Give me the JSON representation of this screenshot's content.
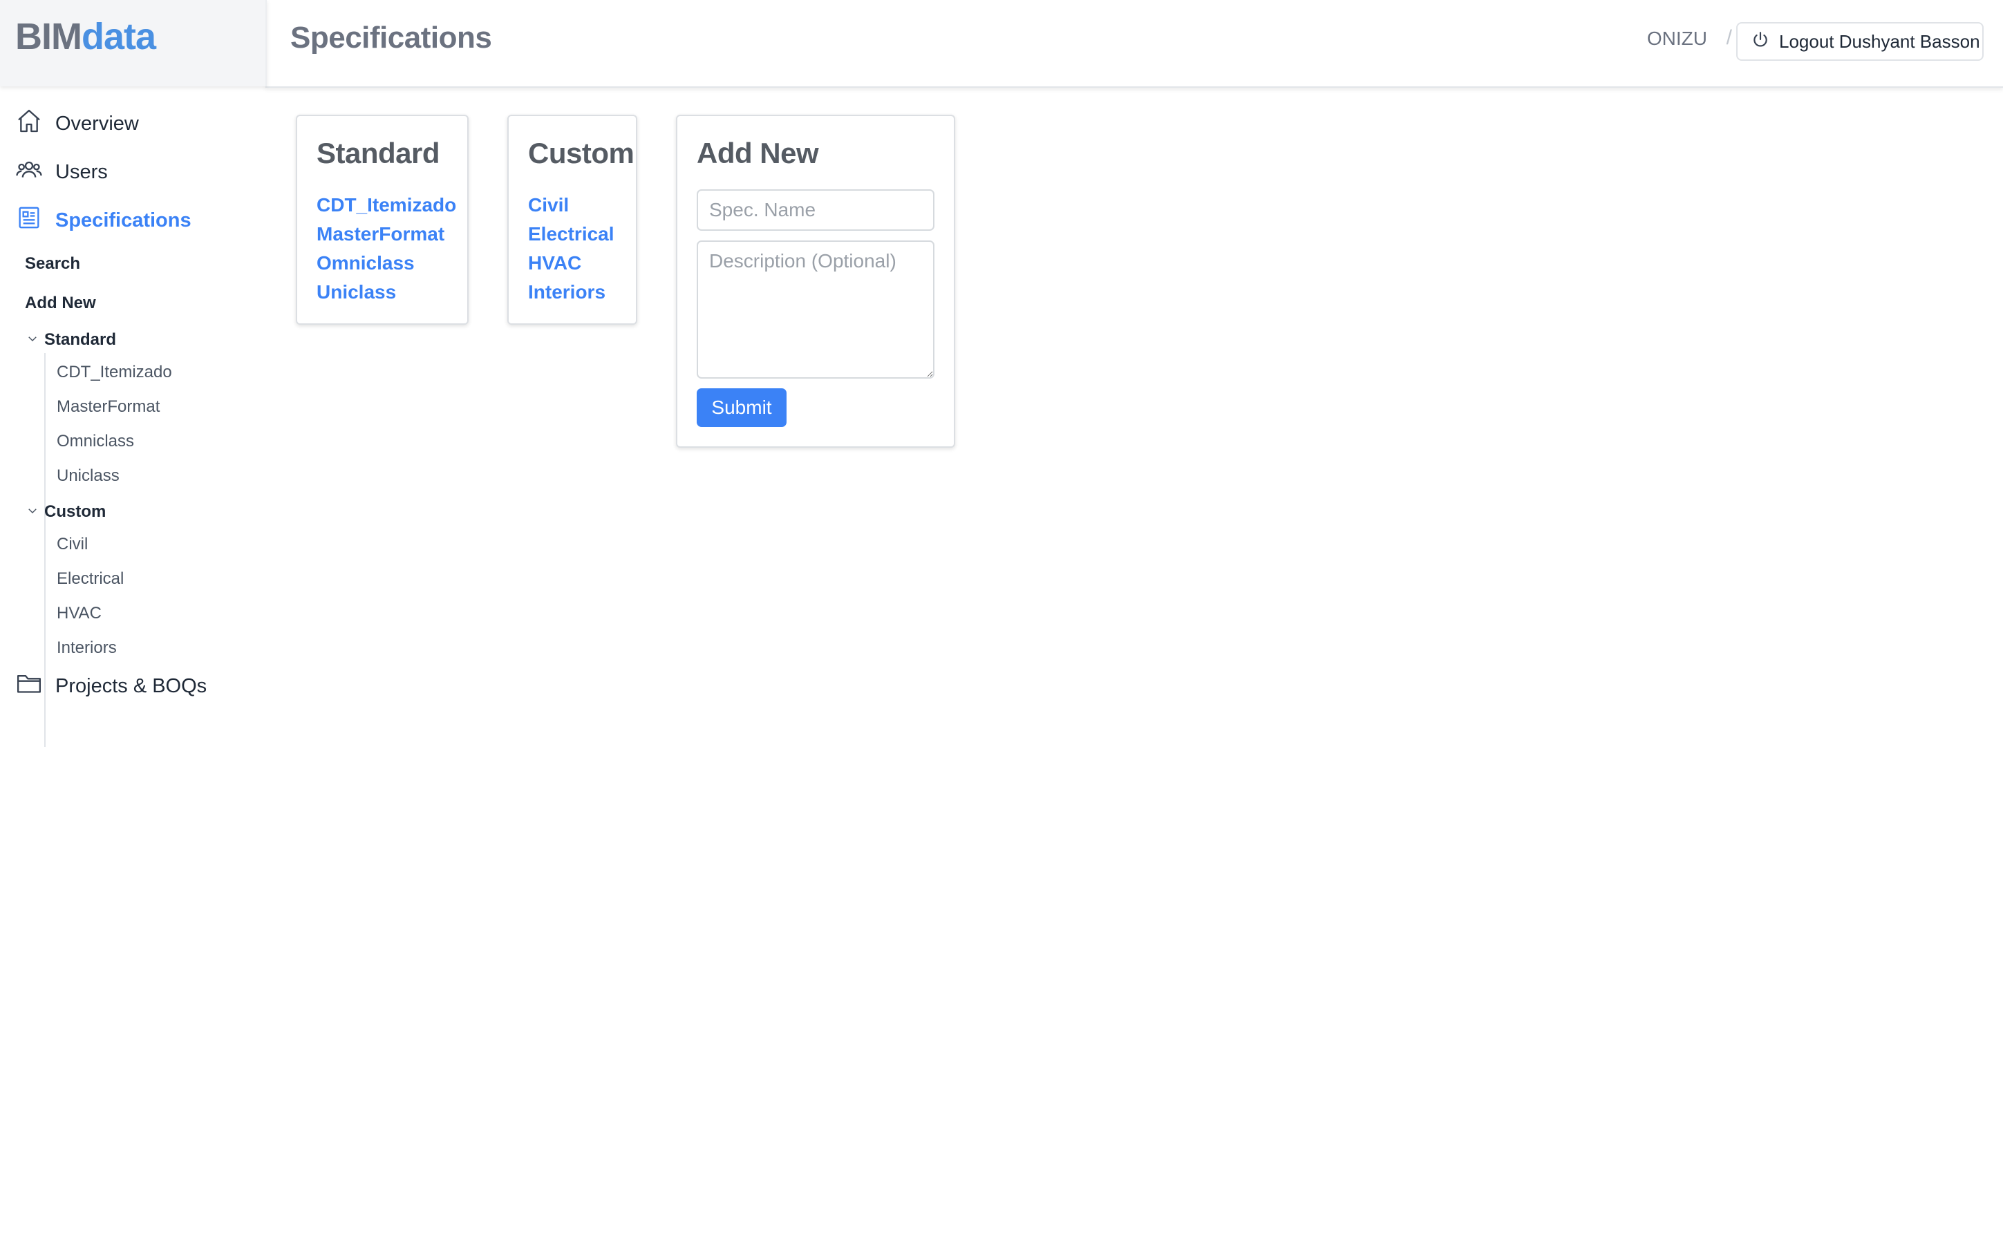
{
  "app": {
    "logo_part1": "BIM",
    "logo_part2": "data"
  },
  "header": {
    "title": "Specifications",
    "org": "ONIZU",
    "separator": "/",
    "logout_label": "Logout Dushyant Basson"
  },
  "sidebar": {
    "nav": {
      "overview": "Overview",
      "users": "Users",
      "specifications": "Specifications",
      "projects": "Projects & BOQs"
    },
    "sub_links": {
      "search": "Search",
      "add_new": "Add New"
    },
    "standard": {
      "label": "Standard",
      "items": [
        "CDT_Itemizado",
        "MasterFormat",
        "Omniclass",
        "Uniclass"
      ]
    },
    "custom": {
      "label": "Custom",
      "items": [
        "Civil",
        "Electrical",
        "HVAC",
        "Interiors"
      ]
    }
  },
  "main": {
    "standard_card": {
      "title": "Standard",
      "links": [
        "CDT_Itemizado",
        "MasterFormat",
        "Omniclass",
        "Uniclass"
      ]
    },
    "custom_card": {
      "title": "Custom",
      "links": [
        "Civil",
        "Electrical",
        "HVAC",
        "Interiors"
      ]
    },
    "add_card": {
      "title": "Add New",
      "name_placeholder": "Spec. Name",
      "desc_placeholder": "Description (Optional)",
      "submit_label": "Submit"
    }
  },
  "colors": {
    "accent": "#3b82f6",
    "logo_blue": "#4a90e2",
    "logo_gray": "#6b7280"
  },
  "icons": [
    "home-icon",
    "users-icon",
    "specifications-icon",
    "folder-icon",
    "power-icon",
    "chevron-down-icon"
  ]
}
